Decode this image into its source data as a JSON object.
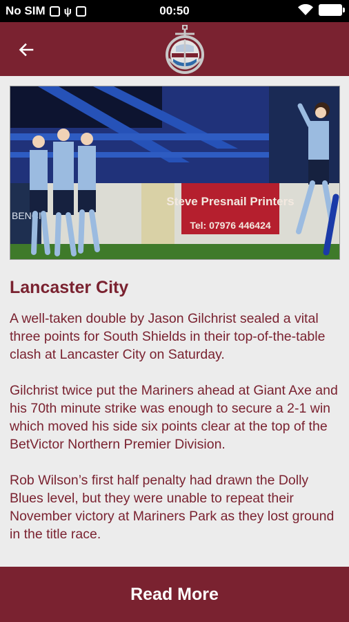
{
  "status_bar": {
    "carrier": "No SIM",
    "time": "00:50"
  },
  "app_bar": {
    "back_icon": "arrow-left-icon",
    "logo_icon": "club-crest-logo"
  },
  "hero_image": {
    "sign_line1": "Steve Presnail Printers",
    "sign_line2": "Tel: 07976 446424",
    "board_text": "BENCI"
  },
  "article": {
    "title": "Lancaster City",
    "paragraphs": [
      "A well-taken double by Jason Gilchrist sealed a vital three points for South Shields in their top-of-the-table clash at Lancaster City on Saturday.",
      "Gilchrist twice put the Mariners ahead at Giant Axe and his 70th minute strike was enough to secure a 2-1 win which moved his side six points clear at the top of the BetVictor Northern Premier Division.",
      "Rob Wilson’s first half penalty had drawn the Dolly Blues level, but they were unable to repeat their November victory at Mariners Park as they lost ground in the title race."
    ]
  },
  "read_more_label": "Read More",
  "colors": {
    "primary": "#7a2230",
    "background": "#ececec",
    "text": "#7a2230"
  }
}
